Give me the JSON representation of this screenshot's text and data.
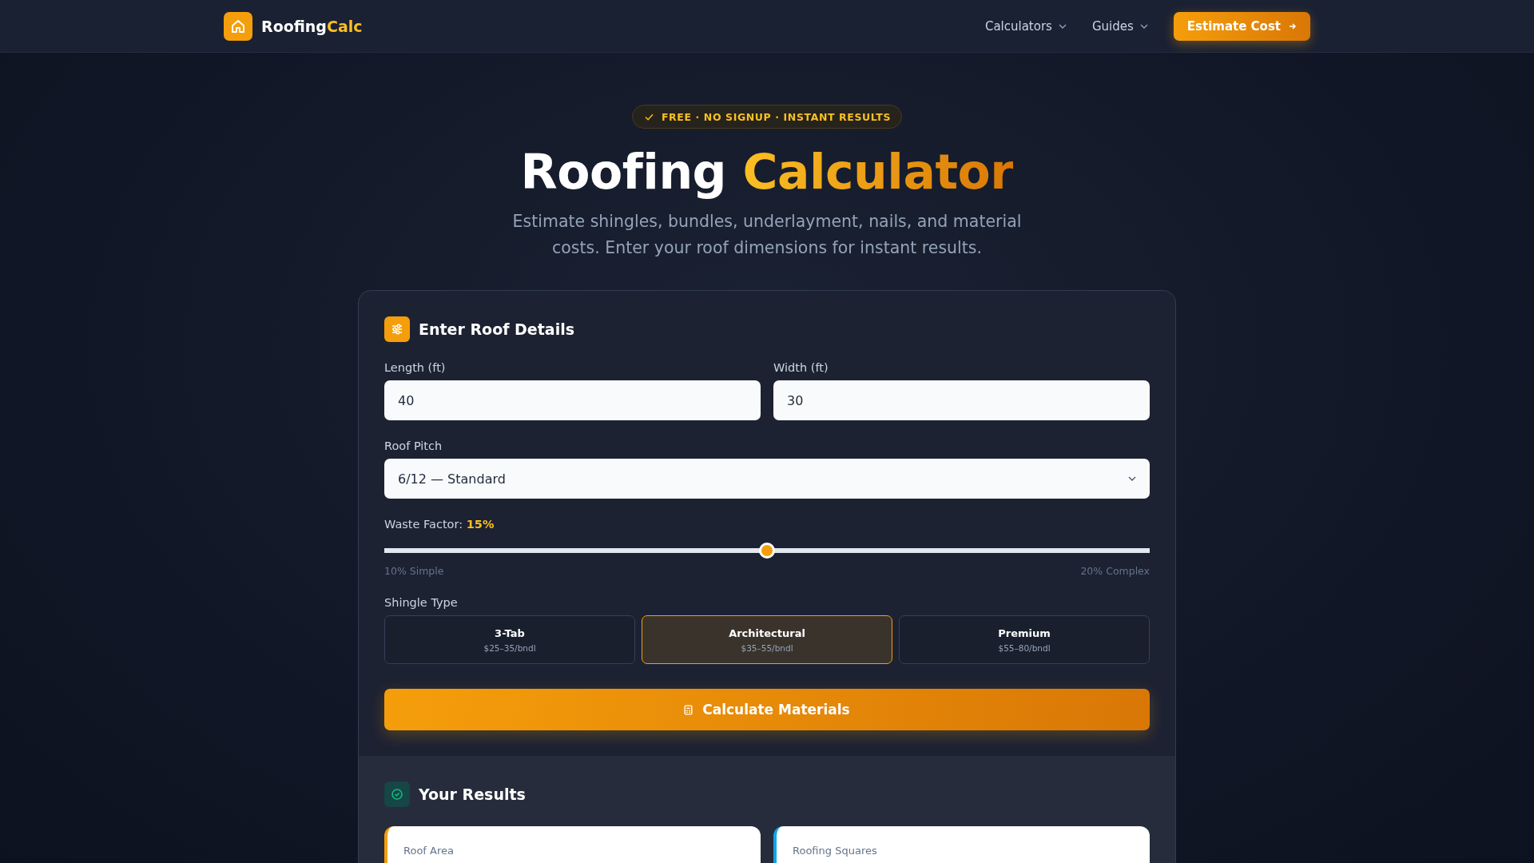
{
  "header": {
    "logo_first": "Roofing",
    "logo_second": "Calc",
    "nav": [
      {
        "label": "Calculators",
        "kind": "dropdown"
      },
      {
        "label": "Guides",
        "kind": "dropdown"
      }
    ],
    "cta": "Estimate Cost"
  },
  "hero": {
    "badge": "FREE · NO SIGNUP · INSTANT RESULTS",
    "title_first": "Roofing",
    "title_second": "Calculator",
    "subtitle": "Estimate shingles, bundles, underlayment, nails, and material costs. Enter your roof dimensions for instant results."
  },
  "form": {
    "title": "Enter Roof Details",
    "fields": [
      {
        "label": "Length (ft)",
        "value": "40"
      },
      {
        "label": "Width (ft)",
        "value": "30"
      }
    ],
    "pitch": {
      "label": "Roof Pitch",
      "value": "6/12 — Standard"
    },
    "waste": {
      "label": "Waste Factor:",
      "reading": "15%",
      "level": 0.5,
      "min_label": "10% Simple",
      "max_label": "20% Complex"
    },
    "shingle_label": "Shingle Type",
    "shingles": [
      {
        "name": "3-Tab",
        "price": "$25–35/bndl",
        "selected": false
      },
      {
        "name": "Architectural",
        "price": "$35–55/bndl",
        "selected": true
      },
      {
        "name": "Premium",
        "price": "$55–80/bndl",
        "selected": false
      }
    ],
    "button": "Calculate Materials"
  },
  "results": {
    "title": "Your Results",
    "cards": [
      {
        "label": "Roof Area",
        "color": "#f59e0b"
      },
      {
        "label": "Roofing Squares",
        "color": "#0ea5e9"
      }
    ]
  }
}
